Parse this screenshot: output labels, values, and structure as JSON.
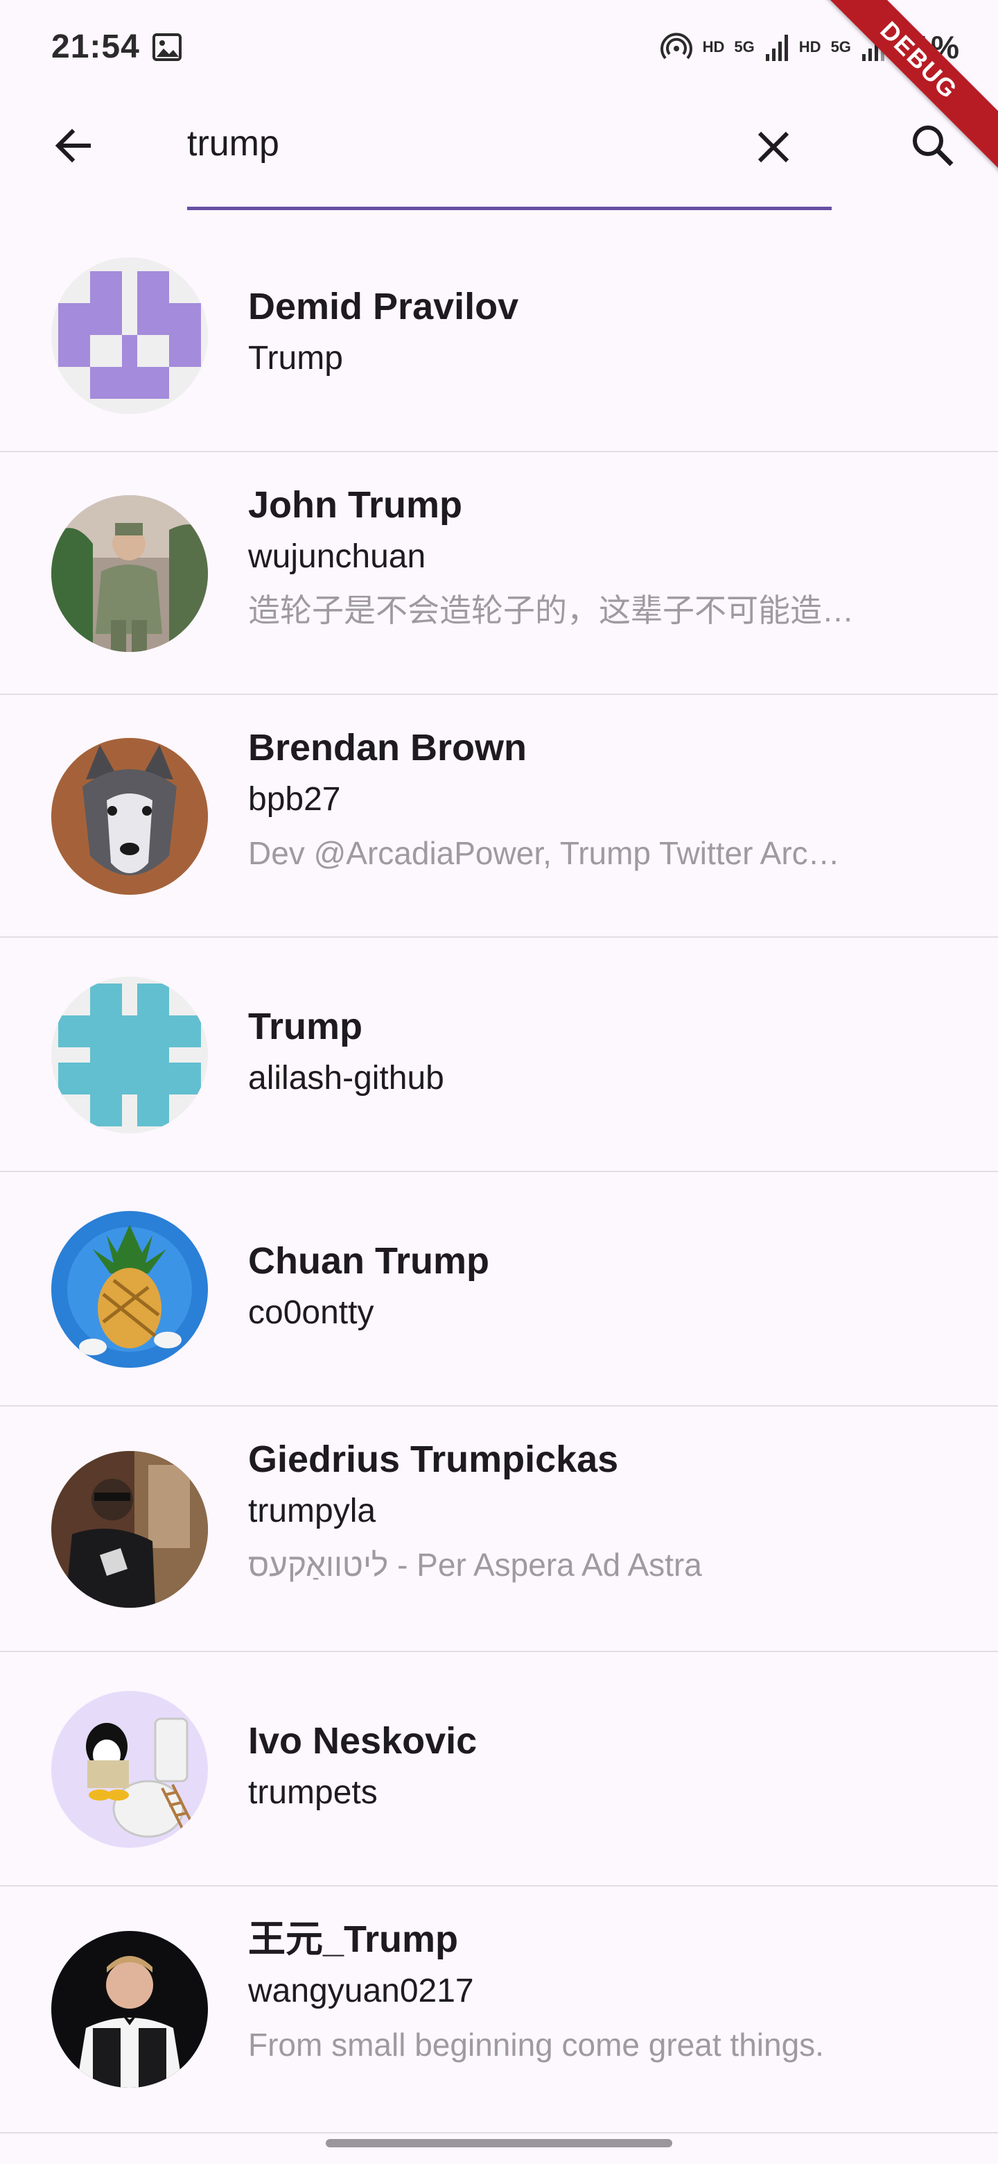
{
  "status_bar": {
    "time": "21:54",
    "hd1": "HD",
    "net1": "5G",
    "hd2": "HD",
    "net2": "5G",
    "battery": "31%"
  },
  "debug_banner": "DEBUG",
  "search": {
    "query": "trump"
  },
  "results": [
    {
      "name": "Demid Pravilov",
      "login": "Trump",
      "bio": ""
    },
    {
      "name": "John Trump",
      "login": "wujunchuan",
      "bio": "造轮子是不会造轮子的，这辈子不可能造…"
    },
    {
      "name": "Brendan Brown",
      "login": "bpb27",
      "bio": "Dev @ArcadiaPower, Trump Twitter Arc…"
    },
    {
      "name": "Trump",
      "login": "alilash-github",
      "bio": ""
    },
    {
      "name": "Chuan Trump",
      "login": "co0ontty",
      "bio": ""
    },
    {
      "name": "Giedrius Trumpickas",
      "login": "trumpyla",
      "bio": "ליטוואַקעס - Per Aspera Ad Astra"
    },
    {
      "name": "Ivo Neskovic",
      "login": "trumpets",
      "bio": ""
    },
    {
      "name": "王元_Trump",
      "login": "wangyuan0217",
      "bio": "From small beginning come great things."
    }
  ],
  "colors": {
    "accent": "#6750a4",
    "background": "#fdf7fe",
    "identicon_purple": "#a48bdb",
    "identicon_teal": "#62bfcf",
    "debug_red": "#b71c24"
  }
}
